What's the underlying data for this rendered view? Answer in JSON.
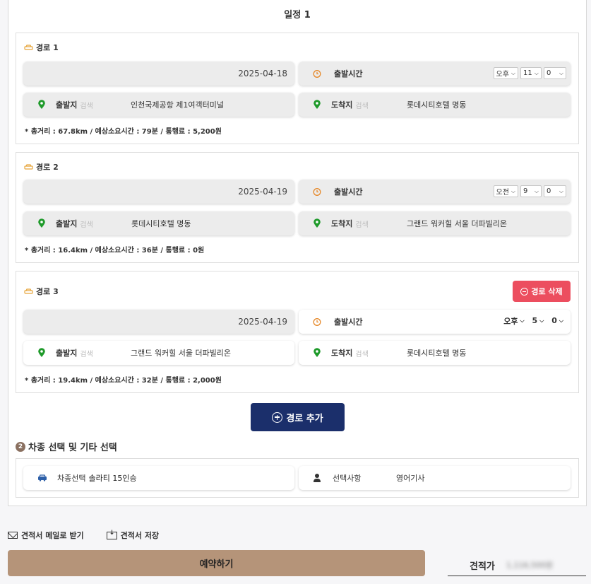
{
  "schedule_title": "일정 1",
  "routes": [
    {
      "title": "경로 1",
      "date": "2025-04-18",
      "time_label": "출발시간",
      "ampm": "오후",
      "hour": "11",
      "minute": "0",
      "departure_label": "출발지",
      "departure_search": "검색",
      "departure": "인천국제공항 제1여객터미널",
      "arrival_label": "도착지",
      "arrival_search": "검색",
      "arrival": "롯데시티호텔 명동",
      "summary": "* 총거리 : 67.8km / 예상소요시간 : 79분 / 통행료 : 5,200원"
    },
    {
      "title": "경로 2",
      "date": "2025-04-19",
      "time_label": "출발시간",
      "ampm": "오전",
      "hour": "9",
      "minute": "0",
      "departure_label": "출발지",
      "departure_search": "검색",
      "departure": "롯데시티호텔 명동",
      "arrival_label": "도착지",
      "arrival_search": "검색",
      "arrival": "그랜드 워커힐 서울 더파빌리온",
      "summary": "* 총거리 : 16.4km / 예상소요시간 : 36분 / 통행료 : 0원"
    },
    {
      "title": "경로 3",
      "date": "2025-04-19",
      "time_label": "출발시간",
      "ampm": "오후",
      "hour": "5",
      "minute": "0",
      "departure_label": "출발지",
      "departure_search": "검색",
      "departure": "그랜드 워커힐 서울 더파빌리온",
      "arrival_label": "도착지",
      "arrival_search": "검색",
      "arrival": "롯데시티호텔 명동",
      "summary": "* 총거리 : 19.4km / 예상소요시간 : 32분 / 통행료 : 2,000원",
      "delete_label": "경로 삭제"
    }
  ],
  "add_route_label": "경로 추가",
  "section2": {
    "number": "2",
    "title": "차종 선택 및 기타 선택",
    "vehicle_label": "차종선택",
    "vehicle_value": "솔라티 15인승",
    "option_label": "선택사항",
    "option_value": "영어기사"
  },
  "bottom": {
    "email_label": "견적서 메일로 받기",
    "save_label": "견적서 저장",
    "reserve_label": "예약하기",
    "quote_label": "견적가",
    "quote_value": "1,116,500원"
  },
  "colors": {
    "navy": "#1b2f6b",
    "delete_red": "#ec4e5f",
    "reserve_tan": "#b59479",
    "pin_green": "#1e9a2a",
    "clock_orange": "#e6892a"
  }
}
